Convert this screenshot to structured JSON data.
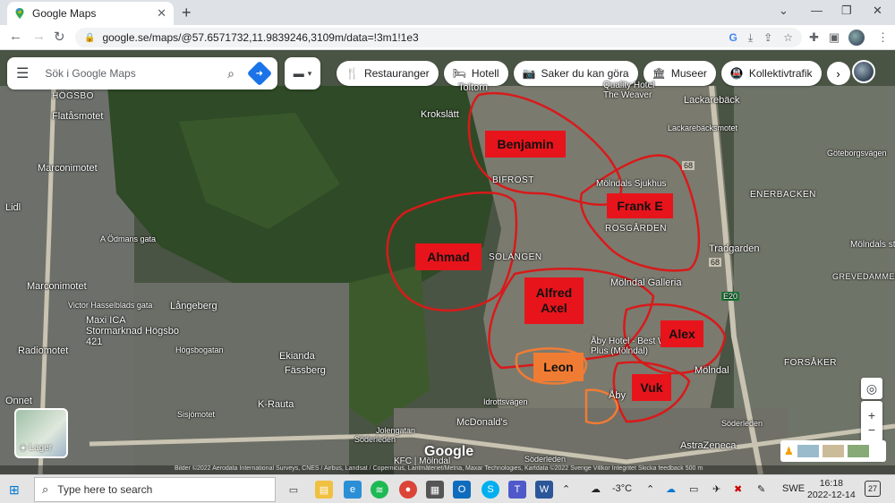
{
  "browser": {
    "tab_title": "Google Maps",
    "tab_close": "✕",
    "new_tab": "+",
    "url": "google.se/maps/@57.6571732,11.9839246,3109m/data=!3m1!1e3",
    "window_controls": [
      "⌄",
      "—",
      "❐",
      "✕"
    ]
  },
  "maps": {
    "search_placeholder": "Sök i Google Maps",
    "chips": [
      {
        "icon": "🍴",
        "label": "Restauranger"
      },
      {
        "icon": "🛏",
        "label": "Hotell"
      },
      {
        "icon": "📷",
        "label": "Saker du kan göra"
      },
      {
        "icon": "🏛",
        "label": "Museer"
      },
      {
        "icon": "🚇",
        "label": "Kollektivtrafik"
      }
    ],
    "layers_label": "Lager",
    "google_logo": "Google",
    "attribution": "Bilder ©2022 Aerodata International Surveys, CNES / Airbus, Landsat / Copernicus, Lantmäteriet/Metria, Maxar Technologies, Kartdata ©2022   Sverige   Villkor   Integritet   Skicka feedback   500 m"
  },
  "places": [
    {
      "name": "HÖGSBO"
    },
    {
      "name": "Flatåsmotet"
    },
    {
      "name": "Marconimotet"
    },
    {
      "name": "Lidl"
    },
    {
      "name": "A Ödmans gata"
    },
    {
      "name": "Marconimotet"
    },
    {
      "name": "Victor Hasselblads gata"
    },
    {
      "name": "Maxi ICA Stormarknad Högsbo 421"
    },
    {
      "name": "Radiomotet"
    },
    {
      "name": "Högsbogatan"
    },
    {
      "name": "Långeberg"
    },
    {
      "name": "Ekianda"
    },
    {
      "name": "Fässberg"
    },
    {
      "name": "K-Rauta"
    },
    {
      "name": "Sisjömotet"
    },
    {
      "name": "Jolengatan"
    },
    {
      "name": "Söderleden"
    },
    {
      "name": "McDonald's"
    },
    {
      "name": "Idrottsvägen"
    },
    {
      "name": "KFC | Mölndal"
    },
    {
      "name": "Söderleden"
    },
    {
      "name": "Krokslätt"
    },
    {
      "name": "Toltorn"
    },
    {
      "name": "Quality Hotel The Weaver"
    },
    {
      "name": "Lackarebäck"
    },
    {
      "name": "Lackarebäcksmotet"
    },
    {
      "name": "BIFROST"
    },
    {
      "name": "Mölndals Sjukhus"
    },
    {
      "name": "ROSGÅRDEN"
    },
    {
      "name": "SOLÄNGEN"
    },
    {
      "name": "Tradgarden"
    },
    {
      "name": "ENERBACKEN"
    },
    {
      "name": "Mölndals stad"
    },
    {
      "name": "GREVEDAMMEN"
    },
    {
      "name": "Mölndal Galleria"
    },
    {
      "name": "E20"
    },
    {
      "name": "Åby Hotel - Best Western Plus (Mölndal)"
    },
    {
      "name": "Mölndal"
    },
    {
      "name": "Åby"
    },
    {
      "name": "FORSÅKER"
    },
    {
      "name": "AstraZeneca"
    },
    {
      "name": "Söderleden"
    },
    {
      "name": "Göteborgsvägen"
    },
    {
      "name": "68"
    },
    {
      "name": "68"
    },
    {
      "name": "Onnet"
    }
  ],
  "labels": [
    {
      "name": "benjamin",
      "text": "Benjamin"
    },
    {
      "name": "frank",
      "text": "Frank E"
    },
    {
      "name": "ahmad",
      "text": "Ahmad"
    },
    {
      "name": "alfred",
      "text": "Alfred\nAxel"
    },
    {
      "name": "alex",
      "text": "Alex"
    },
    {
      "name": "leon",
      "text": "Leon"
    },
    {
      "name": "vuk",
      "text": "Vuk"
    }
  ],
  "colors": {
    "outline_red": "#d81a1a",
    "outline_orange": "#f07c33",
    "label_red": "#e8141b"
  },
  "taskbar": {
    "search_placeholder": "Type here to search",
    "weather": "-3°C",
    "lang": "SWE",
    "time": "16:18",
    "date": "2022-12-14",
    "notification_count": "27"
  }
}
